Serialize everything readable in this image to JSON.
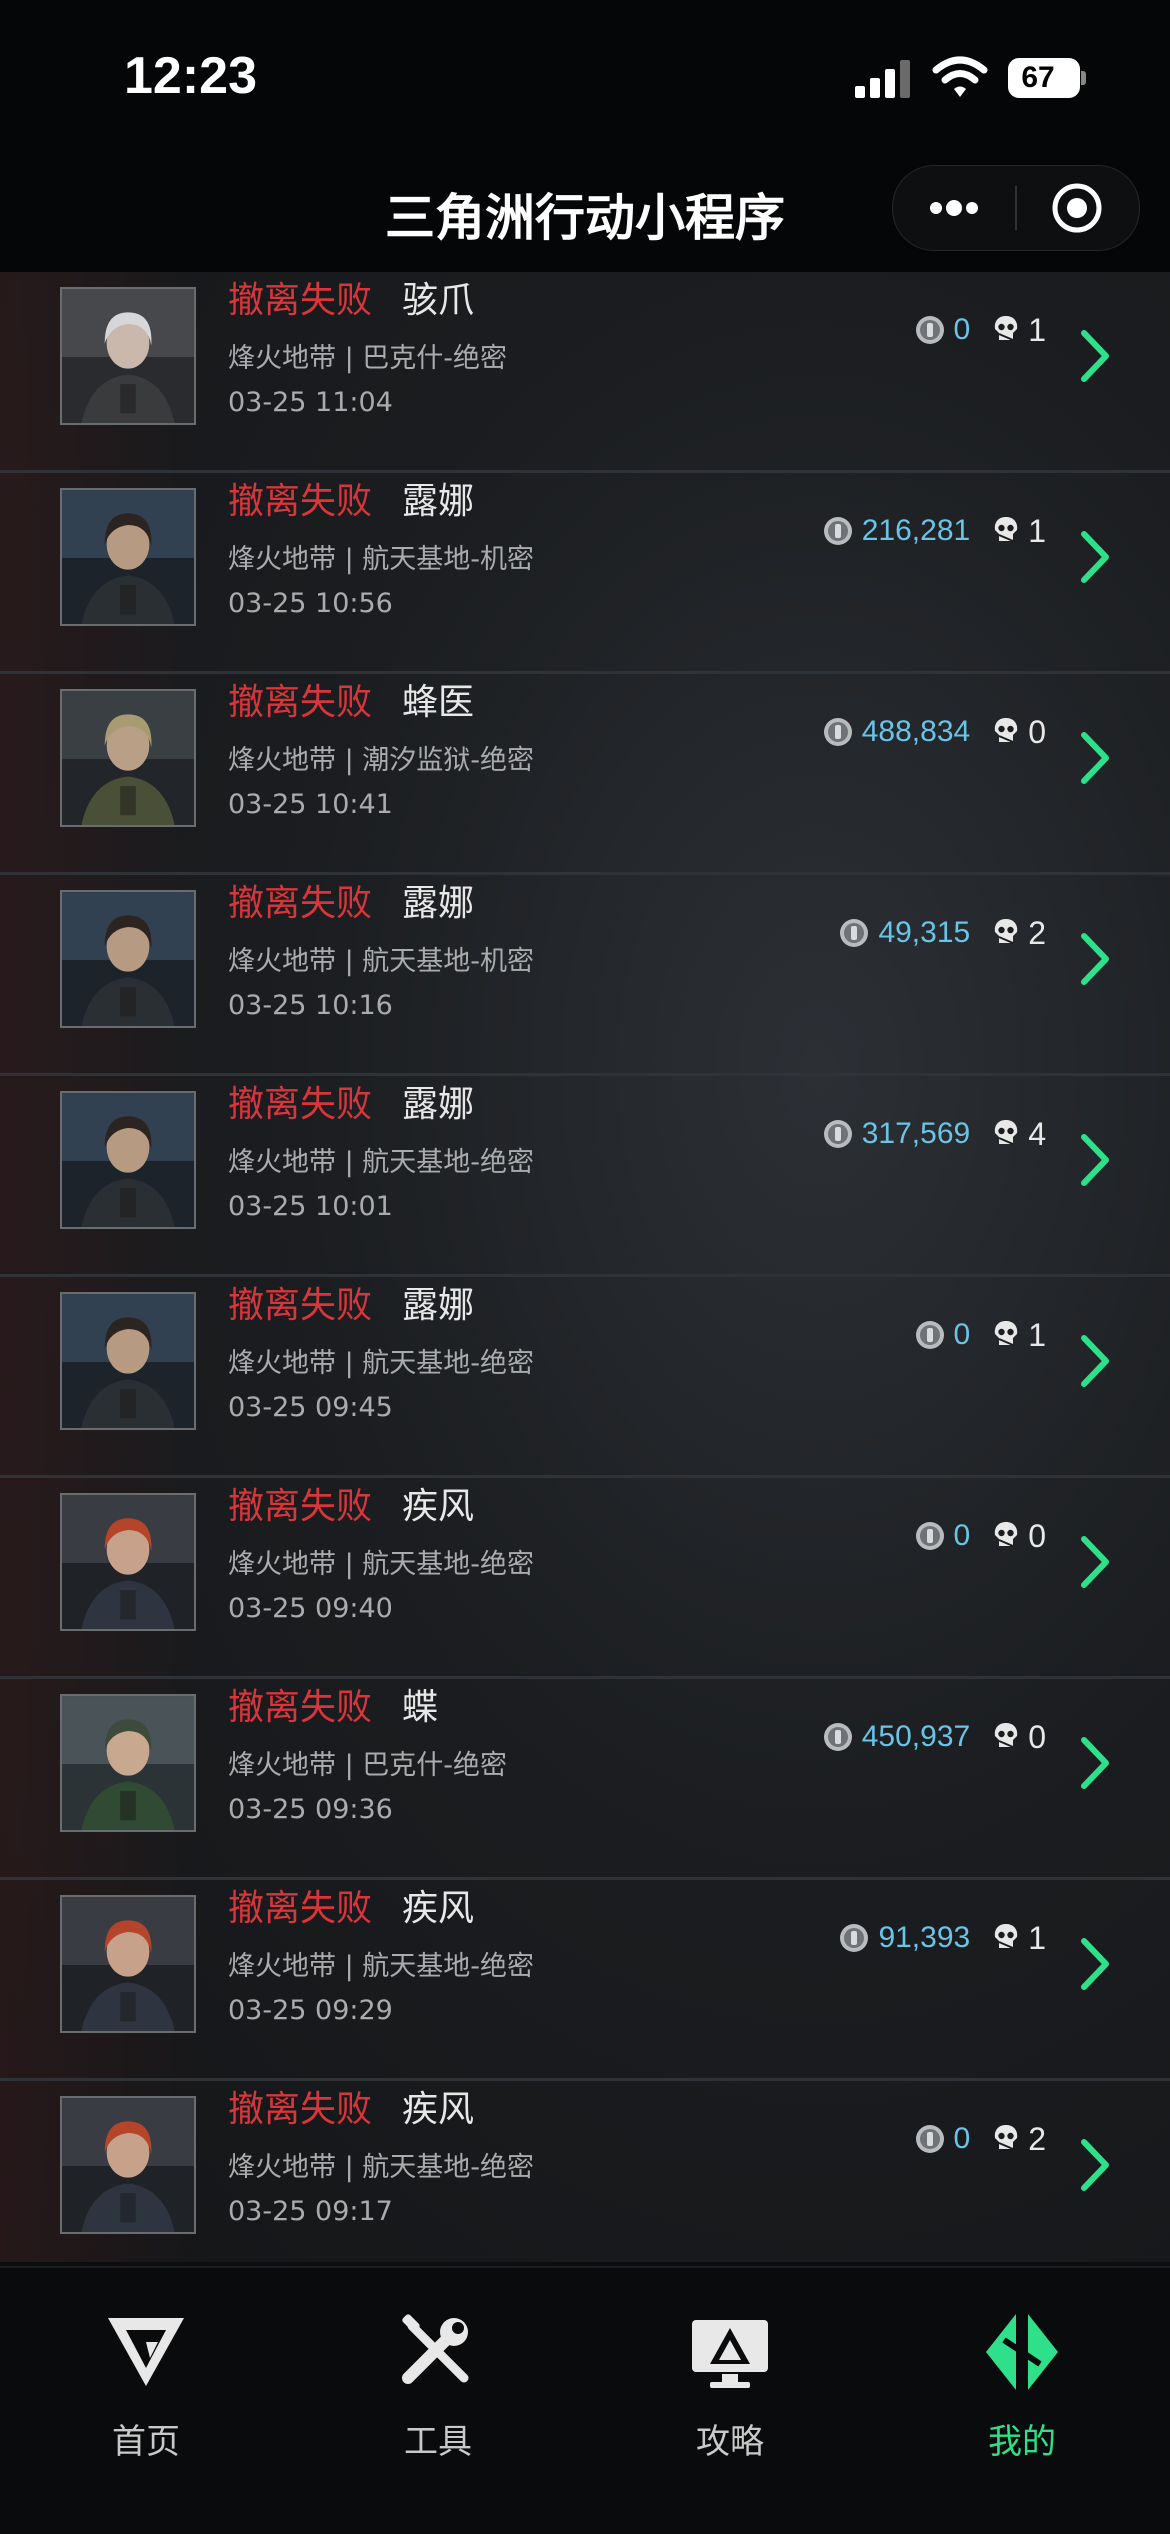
{
  "status_bar": {
    "time": "12:23",
    "battery": "67"
  },
  "nav": {
    "title": "三角洲行动小程序",
    "menu_icon": "more-dots-icon",
    "close_icon": "target-circle-icon"
  },
  "records": [
    {
      "status": "撤离失败",
      "operator": "骇爪",
      "map": "烽火地带 | 巴克什-绝密",
      "date": "03-25 11:04",
      "coins": "0",
      "kills": "1",
      "avatar": "hackclaw"
    },
    {
      "status": "撤离失败",
      "operator": "露娜",
      "map": "烽火地带 | 航天基地-机密",
      "date": "03-25 10:56",
      "coins": "216,281",
      "kills": "1",
      "avatar": "luna"
    },
    {
      "status": "撤离失败",
      "operator": "蜂医",
      "map": "烽火地带 | 潮汐监狱-绝密",
      "date": "03-25 10:41",
      "coins": "488,834",
      "kills": "0",
      "avatar": "medic"
    },
    {
      "status": "撤离失败",
      "operator": "露娜",
      "map": "烽火地带 | 航天基地-机密",
      "date": "03-25 10:16",
      "coins": "49,315",
      "kills": "2",
      "avatar": "luna"
    },
    {
      "status": "撤离失败",
      "operator": "露娜",
      "map": "烽火地带 | 航天基地-绝密",
      "date": "03-25 10:01",
      "coins": "317,569",
      "kills": "4",
      "avatar": "luna"
    },
    {
      "status": "撤离失败",
      "operator": "露娜",
      "map": "烽火地带 | 航天基地-绝密",
      "date": "03-25 09:45",
      "coins": "0",
      "kills": "1",
      "avatar": "luna"
    },
    {
      "status": "撤离失败",
      "operator": "疾风",
      "map": "烽火地带 | 航天基地-绝密",
      "date": "03-25 09:40",
      "coins": "0",
      "kills": "0",
      "avatar": "gale"
    },
    {
      "status": "撤离失败",
      "operator": "蝶",
      "map": "烽火地带 | 巴克什-绝密",
      "date": "03-25 09:36",
      "coins": "450,937",
      "kills": "0",
      "avatar": "butterfly"
    },
    {
      "status": "撤离失败",
      "operator": "疾风",
      "map": "烽火地带 | 航天基地-绝密",
      "date": "03-25 09:29",
      "coins": "91,393",
      "kills": "1",
      "avatar": "gale"
    },
    {
      "status": "撤离失败",
      "operator": "疾风",
      "map": "烽火地带 | 航天基地-绝密",
      "date": "03-25 09:17",
      "coins": "0",
      "kills": "2",
      "avatar": "gale"
    }
  ],
  "tabs": [
    {
      "label": "首页",
      "icon": "delta-logo-icon",
      "active": false
    },
    {
      "label": "工具",
      "icon": "tools-icon",
      "active": false
    },
    {
      "label": "攻略",
      "icon": "guide-monitor-icon",
      "active": false
    },
    {
      "label": "我的",
      "icon": "profile-logo-icon",
      "active": true
    }
  ],
  "colors": {
    "fail": "#d8363a",
    "coin": "#69c4e6",
    "accent": "#2fe08a"
  }
}
